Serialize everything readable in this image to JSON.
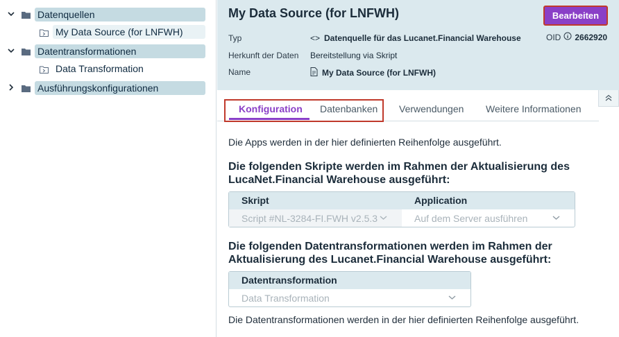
{
  "sidebar": {
    "items": [
      {
        "label": "Datenquellen"
      },
      {
        "label": "My Data Source (for LNFWH)"
      },
      {
        "label": "Datentransformationen"
      },
      {
        "label": "Data Transformation"
      },
      {
        "label": "Ausführungskonfigurationen"
      }
    ]
  },
  "header": {
    "title": "My Data Source (for LNFWH)",
    "edit_label": "Bearbeiten",
    "meta": {
      "typ_label": "Typ",
      "typ_value": "Datenquelle für das Lucanet.Financial Warehouse",
      "herkunft_label": "Herkunft der Daten",
      "herkunft_value": "Bereitstellung via Skript",
      "name_label": "Name",
      "name_value": "My Data Source (for LNFWH)"
    },
    "oid_label": "OID",
    "oid_value": "2662920"
  },
  "tabs": [
    {
      "label": "Konfiguration"
    },
    {
      "label": "Datenbanken"
    },
    {
      "label": "Verwendungen"
    },
    {
      "label": "Weitere Informationen"
    }
  ],
  "content": {
    "intro": "Die Apps werden in der hier definierten Reihenfolge ausgeführt.",
    "scripts_heading": "Die folgenden Skripte werden im Rahmen der Aktualisierung des LucaNet.Financial Warehouse ausgeführt:",
    "scripts_table": {
      "col_script": "Skript",
      "col_application": "Application",
      "script_value": "Script #NL-3284-FI.FWH v2.5.3",
      "application_value": "Auf dem Server ausführen"
    },
    "transforms_heading": "Die folgenden Datentransformationen werden im Rahmen der Aktualisierung des Lucanet.Financial Warehouse ausgeführt:",
    "transforms_table": {
      "col": "Datentransformation",
      "value": "Data Transformation"
    },
    "footer_note": "Die Datentransformationen werden in der hier definierten Reihenfolge ausgeführt."
  },
  "colors": {
    "accent": "#8a3fc7",
    "highlight": "#c0392b",
    "header_bg": "#dbe9ee",
    "sidebar_group_bg": "#c5dbe2"
  }
}
